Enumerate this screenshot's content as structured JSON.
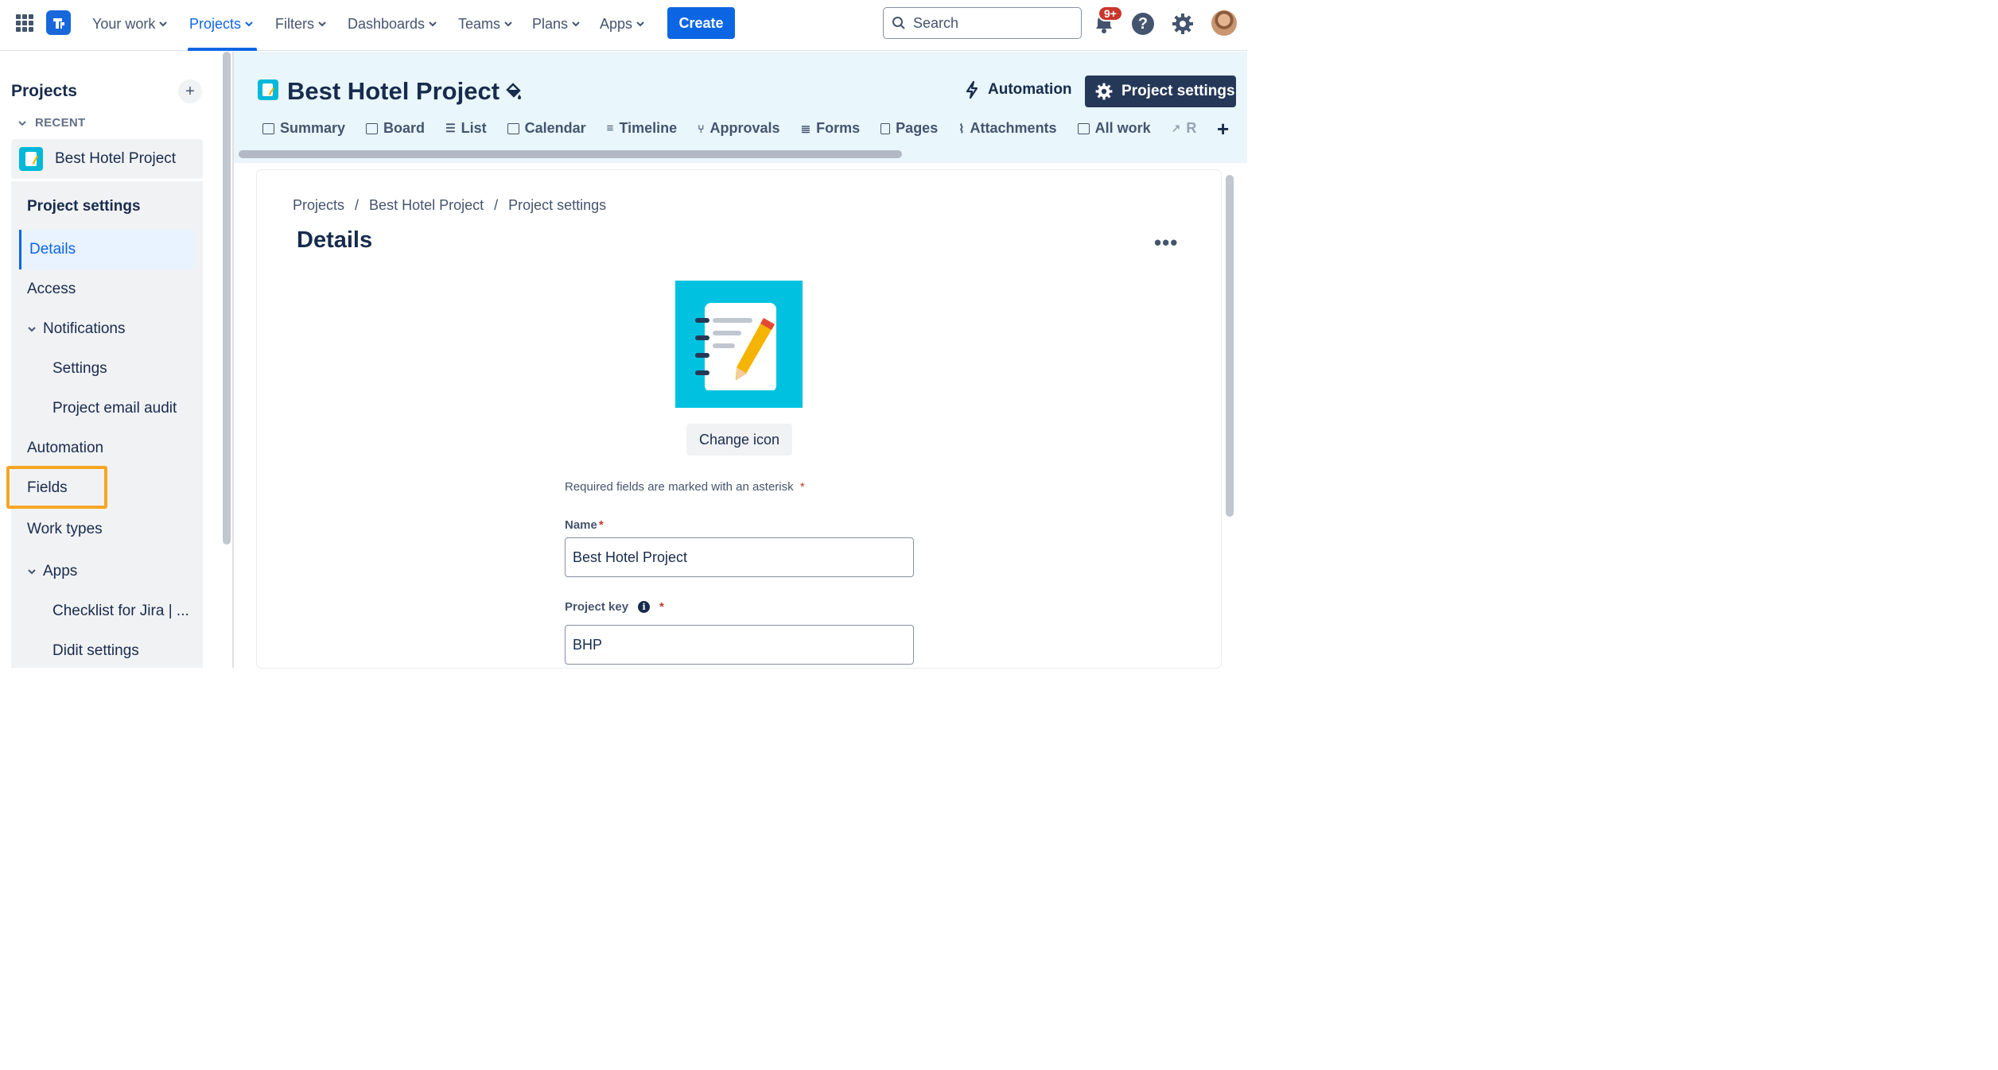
{
  "topnav": {
    "items": [
      {
        "label": "Your work"
      },
      {
        "label": "Projects"
      },
      {
        "label": "Filters"
      },
      {
        "label": "Dashboards"
      },
      {
        "label": "Teams"
      },
      {
        "label": "Plans"
      },
      {
        "label": "Apps"
      }
    ],
    "create_label": "Create",
    "search_placeholder": "Search",
    "notification_count": "9+",
    "help_glyph": "?",
    "accent": "#0c66e4"
  },
  "sidebar": {
    "title": "Projects",
    "add_glyph": "+",
    "recent_label": "RECENT",
    "recent_project": "Best Hotel Project",
    "section_heading": "Project settings",
    "items": [
      {
        "label": "Details"
      },
      {
        "label": "Access"
      },
      {
        "label": "Notifications"
      },
      {
        "label": "Settings"
      },
      {
        "label": "Project email audit"
      },
      {
        "label": "Automation"
      },
      {
        "label": "Fields"
      },
      {
        "label": "Work types"
      },
      {
        "label": "Apps"
      },
      {
        "label": "Checklist for Jira | ..."
      },
      {
        "label": "Didit settings"
      }
    ],
    "highlight_color": "#f5a623"
  },
  "project_header": {
    "title": "Best Hotel Project",
    "automation_label": "Automation",
    "settings_label": "Project settings",
    "tabs": [
      {
        "label": "Summary"
      },
      {
        "label": "Board"
      },
      {
        "label": "List"
      },
      {
        "label": "Calendar"
      },
      {
        "label": "Timeline"
      },
      {
        "label": "Approvals"
      },
      {
        "label": "Forms"
      },
      {
        "label": "Pages"
      },
      {
        "label": "Attachments"
      },
      {
        "label": "All work"
      },
      {
        "label": "R"
      }
    ],
    "add_tab_glyph": "+"
  },
  "main": {
    "breadcrumb": [
      "Projects",
      "/",
      "Best Hotel Project",
      "/",
      "Project settings"
    ],
    "page_title": "Details",
    "more_glyph": "•••",
    "change_icon_label": "Change icon",
    "required_note": "Required fields are marked with an asterisk",
    "asterisk": "*",
    "name_label": "Name",
    "name_value": "Best Hotel Project",
    "key_label": "Project key",
    "info_glyph": "i",
    "key_value": "BHP"
  }
}
